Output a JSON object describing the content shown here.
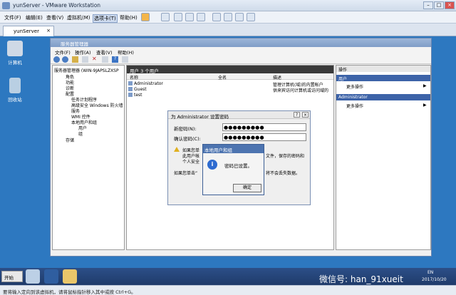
{
  "vm": {
    "title": "yunServer - VMware Workstation",
    "menu": [
      "文件(F)",
      "编辑(E)",
      "查看(V)",
      "虚拟机(M)",
      "选项卡(T)",
      "帮助(H)"
    ],
    "tab": "yunServer"
  },
  "desktop_icons": [
    "计算机",
    "回收站"
  ],
  "server_manager": {
    "title": "服务器管理器",
    "menu": [
      "文件(F)",
      "操作(A)",
      "查看(V)",
      "帮助(H)"
    ],
    "tree": {
      "root": "服务器管理器 (WIN-9JAPSLZXSP",
      "items": [
        "角色",
        "功能",
        "诊断",
        "配置",
        "任务计划程序",
        "高级安全 Windows 防火墙",
        "服务",
        "WMI 控件",
        "本地用户和组",
        "用户",
        "组",
        "存储"
      ]
    },
    "center": {
      "header": "用户  3 个用户",
      "columns": [
        "名称",
        "全名",
        "描述"
      ],
      "rows": [
        {
          "name": "Administrator",
          "desc": "管理计算机(域)的内置帐户"
        },
        {
          "name": "Guest",
          "desc": "供来宾访问计算机或访问域的"
        },
        {
          "name": "test",
          "desc": ""
        }
      ]
    },
    "actions": {
      "header": "操作",
      "section1": "用户",
      "item1": "更多操作",
      "section2": "Administrator",
      "item2": "更多操作"
    }
  },
  "set_password": {
    "title": "为 Administrator 设置密码",
    "new_label": "新密码(N):",
    "confirm_label": "确认密码(C):",
    "masked": "●●●●●●●●●",
    "text1": "如果您单",
    "text2a": "此用户帐",
    "text2b": "文件，保存的密码和",
    "text3": "个人安全",
    "text4a": "如果您单击“",
    "text4b": "将不会丢失数据。"
  },
  "message": {
    "title": "本地用户和组",
    "text": "密码已设置。",
    "ok": "确定",
    "icon": "i"
  },
  "taskbar": {
    "start": "开始",
    "lang": "EN",
    "date": "2017/10/20"
  },
  "status": "要将输入定向到该虚拟机，请将鼠标指针移入其中或按 Ctrl+G。",
  "watermark": "微信号: han_91xueit"
}
